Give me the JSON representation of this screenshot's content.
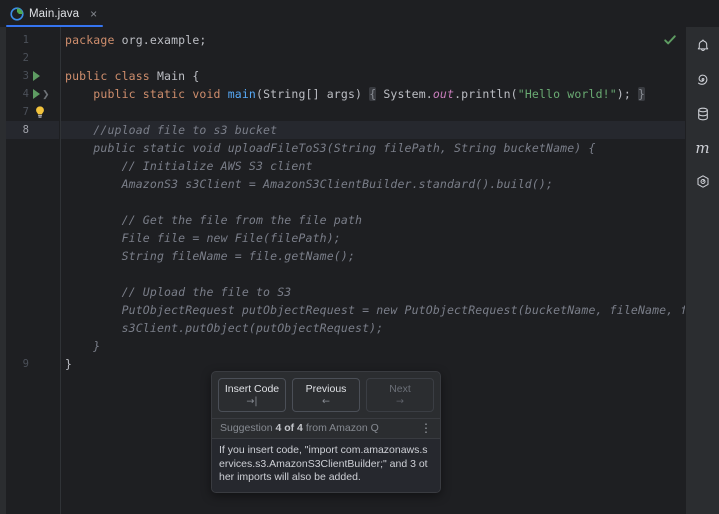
{
  "window": {
    "background": "#1e1f22",
    "accent": "#3574f0"
  },
  "tabbar": {
    "tabs": [
      {
        "label": "Main.java",
        "icon": "java-class-icon",
        "close_label": "×",
        "active": true
      }
    ]
  },
  "editor": {
    "inspection_status": "ok-check",
    "gutter": [
      {
        "num": "1",
        "run": false,
        "fold": false,
        "bulb": false,
        "current": false
      },
      {
        "num": "2",
        "run": false,
        "fold": false,
        "bulb": false,
        "current": false
      },
      {
        "num": "3",
        "run": true,
        "fold": false,
        "bulb": false,
        "current": false
      },
      {
        "num": "4",
        "run": true,
        "fold": true,
        "bulb": false,
        "current": false
      },
      {
        "num": "7",
        "run": false,
        "fold": false,
        "bulb": true,
        "current": false
      },
      {
        "num": "8",
        "run": false,
        "fold": false,
        "bulb": false,
        "current": true
      },
      {
        "num": "9",
        "run": false,
        "fold": false,
        "bulb": false,
        "current": false
      }
    ],
    "lines": [
      "package org.example;",
      "",
      "public class Main {",
      "    public static void main(String[] args) { System.out.println(\"Hello world!\"); }",
      "",
      "    //upload file to s3 bucket",
      "    public static void uploadFileToS3(String filePath, String bucketName) {",
      "        // Initialize AWS S3 client",
      "        AmazonS3 s3Client = AmazonS3ClientBuilder.standard().build();",
      "",
      "        // Get the file from the file path",
      "        File file = new File(filePath);",
      "        String fileName = file.getName();",
      "",
      "        // Upload the file to S3",
      "        PutObjectRequest putObjectRequest = new PutObjectRequest(bucketName, fileName, file);",
      "        s3Client.putObject(putObjectRequest);",
      "    }",
      "}"
    ]
  },
  "suggestion_popup": {
    "buttons": [
      {
        "label": "Insert Code",
        "key": "→|",
        "disabled": false,
        "name": "insert-code-button"
      },
      {
        "label": "Previous",
        "key": "←",
        "disabled": false,
        "name": "previous-suggestion-button"
      },
      {
        "label": "Next",
        "key": "→",
        "disabled": true,
        "name": "next-suggestion-button"
      }
    ],
    "status_prefix": "Suggestion ",
    "status_count": "4 of 4",
    "status_suffix": " from Amazon Q",
    "more_icon": "⋮",
    "body": "If you insert code, \"import com.amazonaws.services.s3.AmazonS3ClientBuilder;\" and 3 other imports will also be added."
  },
  "rightbar": {
    "items": [
      {
        "name": "notifications-bell-icon",
        "glyph": "bell"
      },
      {
        "name": "spiral-icon",
        "glyph": "spiral"
      },
      {
        "name": "database-icon",
        "glyph": "database"
      },
      {
        "name": "maven-m-icon",
        "glyph": "m"
      },
      {
        "name": "plugin-hexagon-icon",
        "glyph": "hexagon"
      }
    ]
  }
}
